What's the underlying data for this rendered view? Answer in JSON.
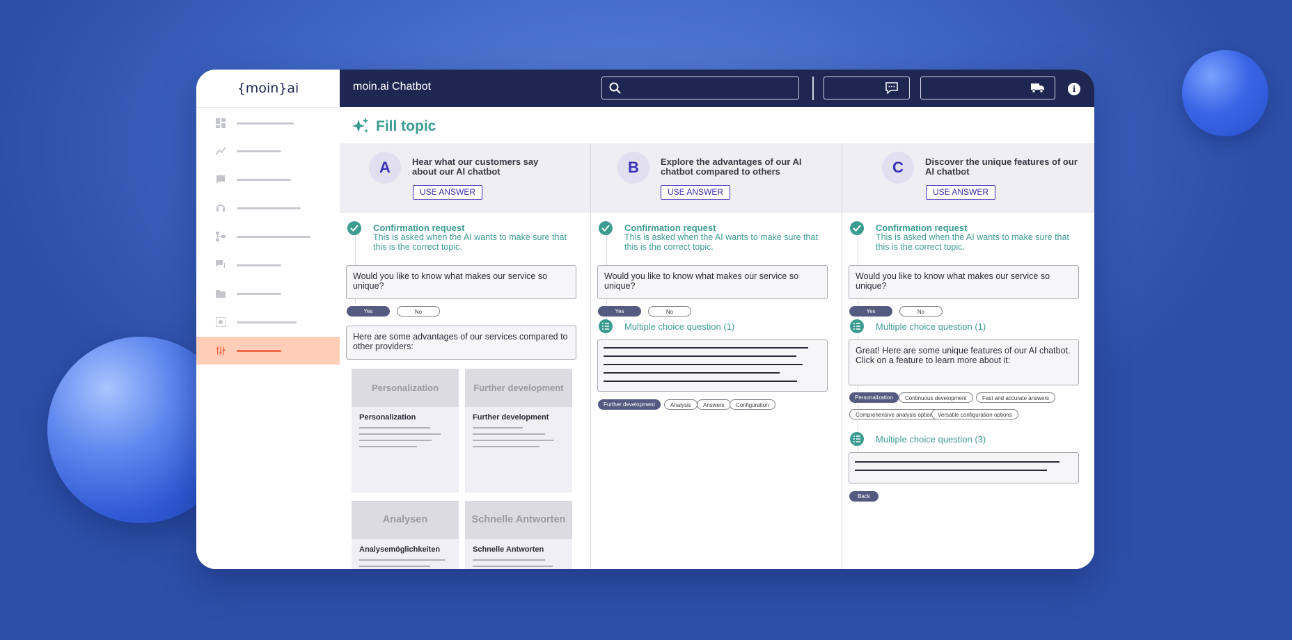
{
  "brand": {
    "logo_text": "{moin}ai"
  },
  "topbar": {
    "title": "moin.ai Chatbot",
    "info_symbol": "i"
  },
  "icons": {
    "sidebar": [
      "dashboard-icon",
      "analytics-icon",
      "chat-icon",
      "support-icon",
      "flow-icon",
      "conversations-icon",
      "files-icon",
      "settings-icon",
      "sliders-icon"
    ]
  },
  "colors": {
    "teal": "#3c9c92",
    "navy": "#1e2752",
    "accent": "#f06a48",
    "accent_bg": "#ffcdb8",
    "purple": "#3a2fb8"
  },
  "page": {
    "title": "Fill topic"
  },
  "columns": [
    {
      "letter": "A",
      "heading": "Hear what our customers say about our AI chatbot",
      "use_answer": "USE ANSWER",
      "confirmation": {
        "title": "Confirmation request",
        "description": "This is asked when the AI wants to make sure that this is the correct topic."
      },
      "question": "Would you like to know what makes our service so unique?",
      "yes": "Yes",
      "no": "No",
      "reply": "Here are some advantages of our services compared to other providers:",
      "cards": [
        {
          "header": "Personalization",
          "title": "Personalization"
        },
        {
          "header": "Further development",
          "title": "Further development"
        },
        {
          "header": "Analysen",
          "title": "Analysemöglichkeiten"
        },
        {
          "header": "Schnelle Antworten",
          "title": "Schnelle Antworten"
        }
      ]
    },
    {
      "letter": "B",
      "heading": "Explore the advantages of our AI chatbot compared to others",
      "use_answer": "USE ANSWER",
      "confirmation": {
        "title": "Confirmation request",
        "description": "This is asked when the AI wants to make sure that this is the correct topic."
      },
      "question": "Would you like to know what makes our service so unique?",
      "yes": "Yes",
      "no": "No",
      "mc_label": "Multiple choice question (1)",
      "chips": [
        "Further development",
        "Analysis",
        "Answers",
        "Configuration"
      ]
    },
    {
      "letter": "C",
      "heading": "Discover the unique features of our AI chatbot",
      "use_answer": "USE ANSWER",
      "confirmation": {
        "title": "Confirmation request",
        "description": "This is asked when the AI wants to make sure that this is the correct topic."
      },
      "question": "Would you like to know what makes our service so unique?",
      "yes": "Yes",
      "no": "No",
      "mc_label_1": "Multiple choice question (1)",
      "reply": "Great! Here are some unique features of our AI chatbot. Click on a feature to learn more about it:",
      "chips_row1": [
        "Personalization",
        "Continuous development",
        "Fast and accurate answers"
      ],
      "chips_row2": [
        "Comprehensive analysis options",
        "Versatile configuration options"
      ],
      "mc_label_3": "Multiple choice question (3)",
      "back": "Back"
    }
  ]
}
